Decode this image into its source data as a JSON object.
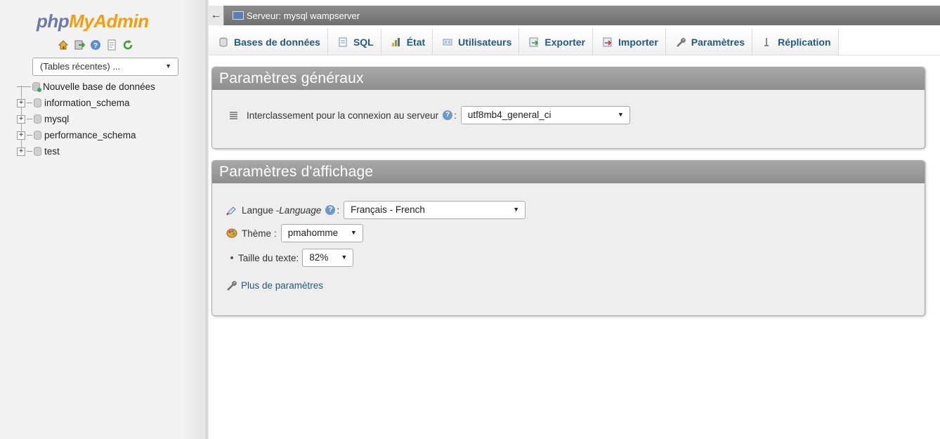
{
  "logo": {
    "part1": "php",
    "part2": "MyAdmin"
  },
  "nav": {
    "icons": [
      "home-icon",
      "exit-icon",
      "help-icon",
      "docs-icon",
      "reload-icon"
    ],
    "recent_tables": "(Tables récentes) ...",
    "tree": [
      {
        "label": "Nouvelle base de données",
        "kind": "new"
      },
      {
        "label": "information_schema",
        "kind": "db"
      },
      {
        "label": "mysql",
        "kind": "db"
      },
      {
        "label": "performance_schema",
        "kind": "db"
      },
      {
        "label": "test",
        "kind": "db"
      }
    ]
  },
  "serverbar": {
    "back": "←",
    "title": "Serveur: mysql wampserver"
  },
  "menu": {
    "tabs": [
      {
        "label": "Bases de données",
        "icon": "database-icon"
      },
      {
        "label": "SQL",
        "icon": "sql-icon"
      },
      {
        "label": "État",
        "icon": "status-icon"
      },
      {
        "label": "Utilisateurs",
        "icon": "users-icon"
      },
      {
        "label": "Exporter",
        "icon": "export-icon"
      },
      {
        "label": "Importer",
        "icon": "import-icon"
      },
      {
        "label": "Paramètres",
        "icon": "wrench-icon"
      },
      {
        "label": "Réplication",
        "icon": "replication-icon"
      }
    ]
  },
  "general": {
    "title": "Paramètres généraux",
    "collation_label": "Interclassement pour la connexion au serveur",
    "collation_value": "utf8mb4_general_ci"
  },
  "display": {
    "title": "Paramètres d'affichage",
    "language_label": "Langue - ",
    "language_label_italic": "Language",
    "language_value": "Français - French",
    "theme_label": "Thème",
    "theme_value": "pmahomme",
    "fontsize_label": "Taille du texte:",
    "fontsize_value": "82%",
    "more_settings": "Plus de paramètres"
  },
  "colors": {
    "accent": "#235a81",
    "logo_php": "#6c78af",
    "logo_myadmin": "#f89c0e",
    "header_gray": "#999999"
  }
}
